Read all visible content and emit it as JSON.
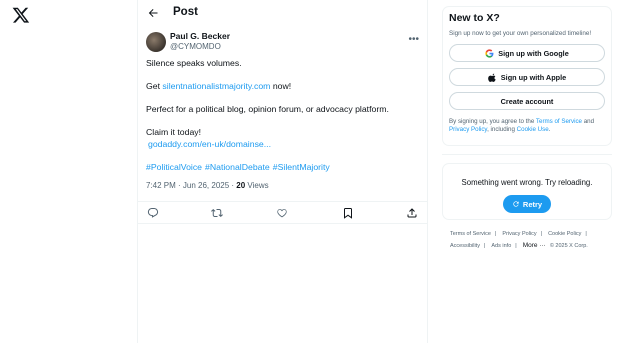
{
  "post_header": {
    "title": "Post"
  },
  "author": {
    "name": "Paul G. Becker",
    "handle": "@CYMOMDO"
  },
  "tweet": {
    "line1": "Silence speaks volumes.",
    "line2_prefix": "Get ",
    "line2_link": "silentnationalistmajority.com",
    "line2_suffix": " now!",
    "line3": "Perfect for a political blog, opinion forum, or advocacy platform.",
    "line4": "Claim it today!",
    "line5_link": "godaddy.com/en-uk/domainse...",
    "hashtags": [
      "#PoliticalVoice",
      "#NationalDebate",
      "#SilentMajority"
    ]
  },
  "meta": {
    "time": "7:42 PM · Jun 26, 2025 · ",
    "views_count": "20",
    "views_label": " Views"
  },
  "actions": [
    "reply-icon",
    "retweet-icon",
    "like-icon",
    "bookmark-icon",
    "share-icon"
  ],
  "signup": {
    "title": "New to X?",
    "subtitle": "Sign up now to get your own personalized timeline!",
    "google_label": "Sign up with Google",
    "apple_label": "Sign up with Apple",
    "create_label": "Create account",
    "terms_prefix": "By signing up, you agree to the ",
    "terms_link": "Terms of Service",
    "terms_and": " and ",
    "privacy_link": "Privacy Policy",
    "terms_including": ", including ",
    "cookie_link": "Cookie Use",
    "terms_end": "."
  },
  "error": {
    "text": "Something went wrong. Try reloading.",
    "retry_label": "Retry"
  },
  "footer": {
    "terms": "Terms of Service",
    "privacy": "Privacy Policy",
    "cookie": "Cookie Policy",
    "accessibility": "Accessibility",
    "ads": "Ads info",
    "more": "More ···",
    "copyright": "© 2025 X Corp.",
    "sep": "|"
  },
  "colors": {
    "accent": "#1d9bf0",
    "text": "#0f1419",
    "muted": "#536471",
    "border": "#eff3f4"
  }
}
